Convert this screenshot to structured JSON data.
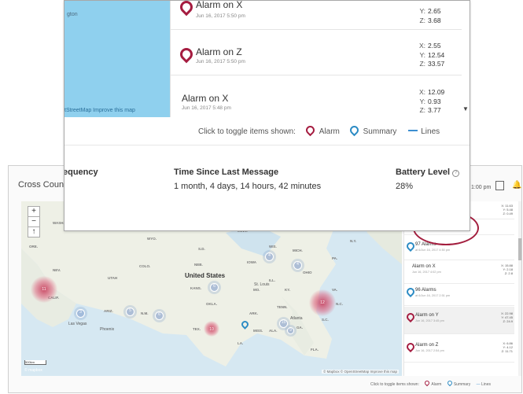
{
  "background": {
    "title": "Cross Coun",
    "time": "1:00 pm",
    "map": {
      "zoom_in": "+",
      "zoom_out": "−",
      "compass": "↑",
      "country_label": "United States",
      "states": [
        "WASH.",
        "ORE.",
        "NEV.",
        "UTAH",
        "COLO.",
        "ARIZ.",
        "N.M.",
        "WYO.",
        "N.D.",
        "S.D.",
        "NEB.",
        "KANS.",
        "OKLA.",
        "TEX.",
        "IOWA",
        "MO.",
        "ARK.",
        "MISS.",
        "ALA.",
        "GA.",
        "TENN.",
        "KY.",
        "ILL.",
        "OHIO",
        "PA.",
        "N.Y.",
        "VA.",
        "S.C.",
        "N.C.",
        "MINN.",
        "WIS.",
        "MICH.",
        "LA.",
        "FLA.",
        "CALIF."
      ],
      "cities": [
        "Las Vegas",
        "Phoenix",
        "St. Louis",
        "Atlanta"
      ],
      "clusters": [
        "11",
        "3",
        "5",
        "6",
        "6",
        "4",
        "4",
        "10",
        "15",
        "9",
        "12"
      ],
      "attribution": "© Mapbox © OpenStreetMap Improve this map",
      "mapbox": "© mapbox",
      "scale": "500km"
    },
    "list": [
      {
        "title": "",
        "date": "",
        "x": "X: 11.63",
        "y": "Y: 5.48",
        "z": "Z: 0.49",
        "pin": "none"
      },
      {
        "title": "",
        "date": "at 6/Jun 16, 2017 5:52 pm",
        "x": "",
        "y": "",
        "z": "",
        "pin": "none"
      },
      {
        "title": "97 Alarms",
        "date": "at 6/Jun 16, 2017 4:50 pm",
        "x": "",
        "y": "",
        "z": "",
        "pin": "blue"
      },
      {
        "title": "Alarm on X",
        "date": "Jun 16, 2017 4:02 pm",
        "x": "X: 15.88",
        "y": "Y: 2.18",
        "z": "Z: 2.8",
        "pin": "none"
      },
      {
        "title": "96 Alarms",
        "date": "at 6/Jun 16, 2017 2:51 pm",
        "x": "",
        "y": "",
        "z": "",
        "pin": "blue"
      },
      {
        "title": "Alarm on Y",
        "date": "Jun 16, 2017 3:45 pm",
        "x": "X: 22.98",
        "y": "Y: 47.45",
        "z": "Z: 24.9",
        "pin": "red"
      },
      {
        "title": "Alarm on Z",
        "date": "Jun 16, 2017 2:54 pm",
        "x": "X: 6.86",
        "y": "Y: 4.12",
        "z": "Z: 11.71",
        "pin": "red"
      }
    ],
    "legend": {
      "prefix": "Click to toggle items shown:",
      "alarm": "Alarm",
      "summary": "Summary",
      "lines": "Lines"
    }
  },
  "zoom": {
    "map_label": "gton",
    "map_attribution": "tStreetMap Improve this map",
    "list": [
      {
        "title": "Alarm on X",
        "date": "Jun 16, 2017 5:50 pm",
        "y": "2.65",
        "z": "3.68"
      },
      {
        "title": "Alarm on Z",
        "date": "Jun 16, 2017 5:50 pm",
        "x": "2.55",
        "y": "12.54",
        "z": "33.57"
      },
      {
        "title": "Alarm on X",
        "date": "Jun 16, 2017 5:48 pm",
        "x": "12.09",
        "y": "0.93",
        "z": "3.77"
      }
    ],
    "axis": {
      "x": "X:",
      "y": "Y:",
      "z": "Z:"
    },
    "legend": {
      "prefix": "Click to toggle items shown:",
      "alarm": "Alarm",
      "summary": "Summary",
      "lines": "Lines"
    },
    "stats": {
      "frequency_label": "equency",
      "time_label": "Time Since Last Message",
      "time_value": "1 month, 4 days, 14 hours, 42 minutes",
      "battery_label": "Battery Level",
      "battery_value": "28%",
      "info": "?"
    }
  },
  "colors": {
    "alarm": "#a51c40",
    "summary": "#2b8bc4",
    "lines": "#3c8fd0",
    "highlight_circle": "#a31e3e"
  },
  "icons": [
    "calendar-icon",
    "bell-icon",
    "pin-icon",
    "info-icon",
    "scroll-arrow-icon"
  ]
}
